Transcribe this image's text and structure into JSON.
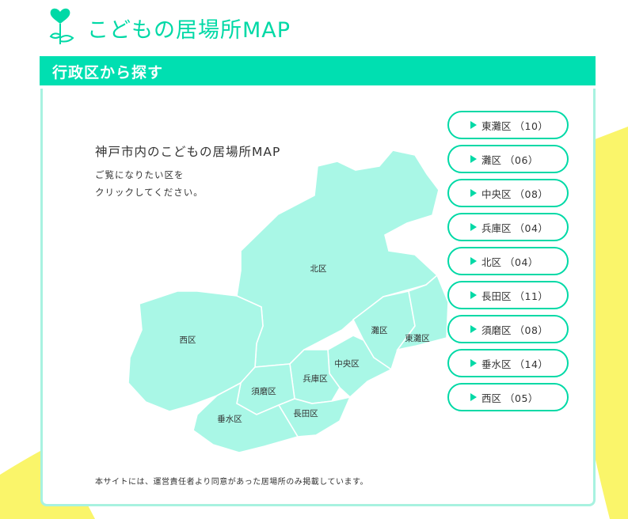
{
  "header": {
    "title": "こどもの居場所MAP",
    "logo_icon": "heart-sprout-icon"
  },
  "section": {
    "title": "行政区から探す"
  },
  "map": {
    "title": "神戸市内のこどもの居場所MAP",
    "instruction_line1": "ご覧になりたい区を",
    "instruction_line2": "クリックしてください。",
    "districts": {
      "kita": "北区",
      "nishi": "西区",
      "nada": "灘区",
      "higashinada": "東灘区",
      "chuo": "中央区",
      "hyogo": "兵庫区",
      "suma": "須磨区",
      "nagata": "長田区",
      "tarumi": "垂水区"
    }
  },
  "wards": [
    {
      "name": "東灘区",
      "count": "（10）"
    },
    {
      "name": "灘区",
      "count": "（06）"
    },
    {
      "name": "中央区",
      "count": "（08）"
    },
    {
      "name": "兵庫区",
      "count": "（04）"
    },
    {
      "name": "北区",
      "count": "（04）"
    },
    {
      "name": "長田区",
      "count": "（11）"
    },
    {
      "name": "須磨区",
      "count": "（08）"
    },
    {
      "name": "垂水区",
      "count": "（14）"
    },
    {
      "name": "西区",
      "count": "（05）"
    }
  ],
  "footer": {
    "note": "本サイトには、運営責任者より同意があった居場所のみ掲載しています。"
  },
  "colors": {
    "accent": "#00dfb1",
    "map_fill": "#a9f7e6",
    "decor_yellow": "#faf56a"
  }
}
